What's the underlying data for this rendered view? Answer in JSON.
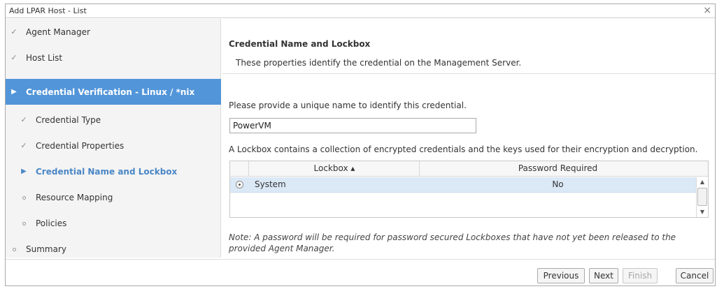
{
  "dialog": {
    "title": "Add LPAR Host - List",
    "close_glyph": "×"
  },
  "nav": {
    "items": [
      {
        "label": "Agent Manager",
        "mark": "✓",
        "state": "done"
      },
      {
        "label": "Host List",
        "mark": "✓",
        "state": "done"
      },
      {
        "label": "Credential Verification - Linux / *nix",
        "mark": "▶",
        "state": "active"
      },
      {
        "label": "Credential Type",
        "mark": "✓",
        "state": "done"
      },
      {
        "label": "Credential Properties",
        "mark": "✓",
        "state": "done"
      },
      {
        "label": "Credential Name and Lockbox",
        "mark": "▶",
        "state": "current"
      },
      {
        "label": "Resource Mapping",
        "mark": "",
        "state": "pending"
      },
      {
        "label": "Policies",
        "mark": "",
        "state": "pending"
      },
      {
        "label": "Summary",
        "mark": "",
        "state": "pending"
      }
    ]
  },
  "main": {
    "section_title": "Credential Name and Lockbox",
    "section_desc": "These properties identify the credential on the Management Server.",
    "name_prompt": "Please provide a unique name to identify this credential.",
    "name_value": "PowerVM",
    "lockbox_prompt": "A Lockbox contains a collection of encrypted credentials and the keys used for their encryption and decryption.",
    "grid": {
      "col_lockbox": "Lockbox ▴",
      "col_password": "Password Required",
      "rows": [
        {
          "lockbox": "System",
          "password_required": "No",
          "selected": true
        }
      ]
    },
    "note": "Note: A password will be required for password secured Lockboxes that have not yet been released to the provided Agent Manager."
  },
  "footer": {
    "previous": "Previous",
    "next": "Next",
    "finish": "Finish",
    "cancel": "Cancel"
  },
  "colors": {
    "active_bg": "#5295d9",
    "current_text": "#4a86c5",
    "selected_row": "#dbe8f6"
  }
}
